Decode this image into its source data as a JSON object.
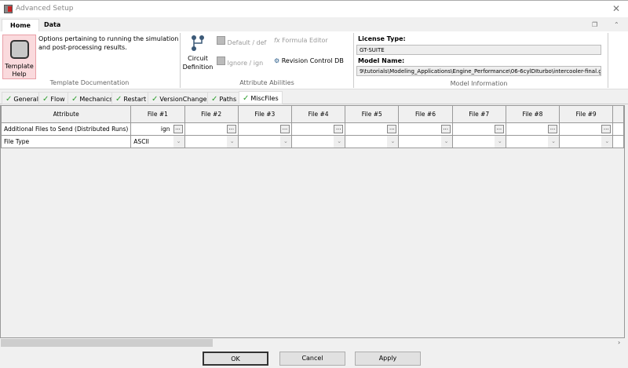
{
  "window": {
    "title": "Advanced Setup"
  },
  "ribbon": {
    "tabs": [
      "Home",
      "Data"
    ],
    "template_help": "Template Help",
    "description": "Options pertaining to running the simulation and post-processing results.",
    "group_template_doc": "Template Documentation",
    "circuit_definition": "Circuit Definition",
    "default_def": "Default / def",
    "ignore_ign": "Ignore / ign",
    "formula_editor": "Formula Editor",
    "revision_control": "Revision Control DB",
    "group_attribute": "Attribute Abilities",
    "license_label": "License Type:",
    "license_value": "GT-SUITE",
    "model_label": "Model Name:",
    "model_value": "9\\tutorials\\Modeling_Applications\\Engine_Performance\\06-6cylDIturbo\\intercooler-final.gtm",
    "group_model": "Model Information"
  },
  "sheet_tabs": [
    "General",
    "Flow",
    "Mechanics",
    "Restart",
    "VersionChanges",
    "Paths",
    "MiscFiles"
  ],
  "active_sheet_tab": "MiscFiles",
  "grid": {
    "headers": [
      "Attribute",
      "File #1",
      "File #2",
      "File #3",
      "File #4",
      "File #5",
      "File #6",
      "File #7",
      "File #8",
      "File #9"
    ],
    "rows": [
      {
        "attribute": "Additional Files to Send (Distributed Runs)",
        "values": [
          "ign",
          "",
          "",
          "",
          "",
          "",
          "",
          "",
          ""
        ]
      },
      {
        "attribute": "File Type",
        "values": [
          "ASCII",
          "",
          "",
          "",
          "",
          "",
          "",
          "",
          ""
        ]
      }
    ]
  },
  "buttons": {
    "ok": "OK",
    "cancel": "Cancel",
    "apply": "Apply"
  }
}
